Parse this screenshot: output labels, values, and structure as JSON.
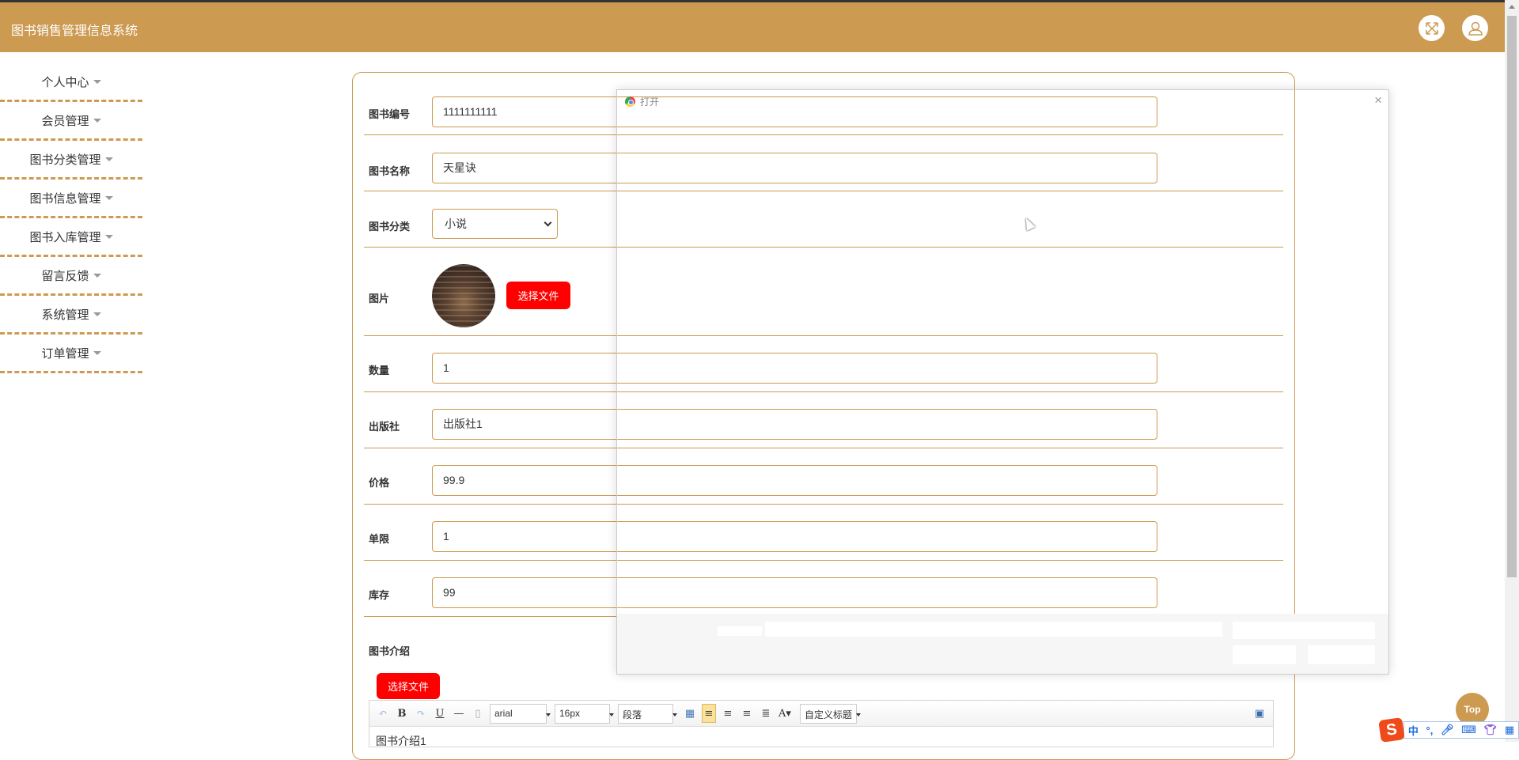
{
  "header": {
    "title": "图书销售管理信息系统",
    "fullscreen_icon": "expand-icon",
    "user_icon": "user-icon"
  },
  "sidebar": {
    "items": [
      {
        "label": "个人中心"
      },
      {
        "label": "会员管理"
      },
      {
        "label": "图书分类管理"
      },
      {
        "label": "图书信息管理"
      },
      {
        "label": "图书入库管理"
      },
      {
        "label": "留言反馈"
      },
      {
        "label": "系统管理"
      },
      {
        "label": "订单管理"
      }
    ]
  },
  "form": {
    "book_no": {
      "label": "图书编号",
      "value": "1111111111"
    },
    "book_name": {
      "label": "图书名称",
      "value": "天星诀"
    },
    "category": {
      "label": "图书分类",
      "value": "小说"
    },
    "image": {
      "label": "图片",
      "button": "选择文件"
    },
    "quantity": {
      "label": "数量",
      "value": "1"
    },
    "publisher": {
      "label": "出版社",
      "value": "出版社1"
    },
    "price": {
      "label": "价格",
      "value": "99.9"
    },
    "limit": {
      "label": "单限",
      "value": "1"
    },
    "stock": {
      "label": "库存",
      "value": "99"
    },
    "intro": {
      "label": "图书介绍",
      "button": "选择文件",
      "content": "图书介绍1",
      "toolbar": {
        "font": "arial",
        "size": "16px",
        "paragraph": "段落",
        "custom_title": "自定义标题"
      }
    }
  },
  "dialog": {
    "title": "打开",
    "close": "×"
  },
  "top_button": "Top",
  "ime": {
    "lang": "中",
    "punct": "°,"
  }
}
